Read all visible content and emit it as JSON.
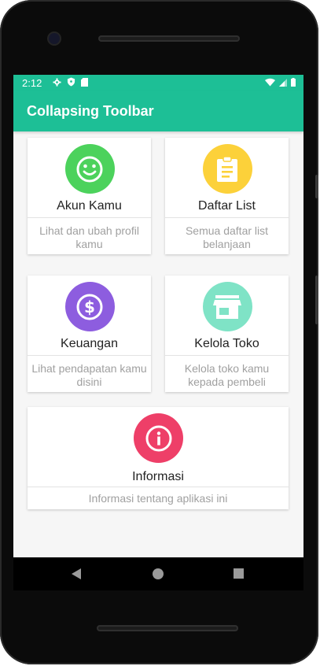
{
  "status_bar": {
    "time": "2:12"
  },
  "toolbar": {
    "title": "Collapsing Toolbar"
  },
  "cards": [
    {
      "title": "Akun Kamu",
      "desc": "Lihat dan ubah profil kamu",
      "icon": "smiley-icon",
      "color": "#4cd25c"
    },
    {
      "title": "Daftar List",
      "desc": "Semua daftar list belanjaan",
      "icon": "clipboard-icon",
      "color": "#fcd13a"
    },
    {
      "title": "Keuangan",
      "desc": "Lihat pendapatan kamu disini",
      "icon": "dollar-icon",
      "color": "#8d5ddf"
    },
    {
      "title": "Kelola Toko",
      "desc": "Kelola toko kamu kepada pembeli",
      "icon": "store-icon",
      "color": "#7fe3c6"
    },
    {
      "title": "Informasi",
      "desc": "Informasi tentang aplikasi ini",
      "icon": "info-icon",
      "color": "#ee3f68"
    }
  ]
}
